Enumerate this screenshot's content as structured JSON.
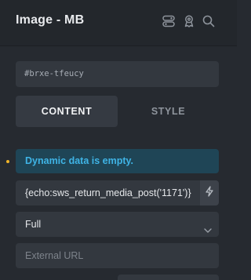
{
  "header": {
    "title": "Image - MB",
    "icons": [
      "toggle-icon",
      "pin-icon",
      "search-icon"
    ]
  },
  "element_id": "#brxe-tfeucy",
  "tabs": [
    {
      "label": "CONTENT",
      "active": true
    },
    {
      "label": "STYLE",
      "active": false
    }
  ],
  "notice": {
    "text": "Dynamic data is empty.",
    "color": "#3fb4e6"
  },
  "dynamic_field": {
    "value": "{echo:sws_return_media_post('1171')}",
    "button_icon": "bolt-icon"
  },
  "size_select": {
    "value": "Full"
  },
  "external_url": {
    "placeholder": "External URL",
    "value": ""
  },
  "colors": {
    "background": "#262a30",
    "header": "#23272c",
    "field": "#33383f",
    "notice_bg": "#1f4556",
    "indicator": "#f0b429"
  }
}
